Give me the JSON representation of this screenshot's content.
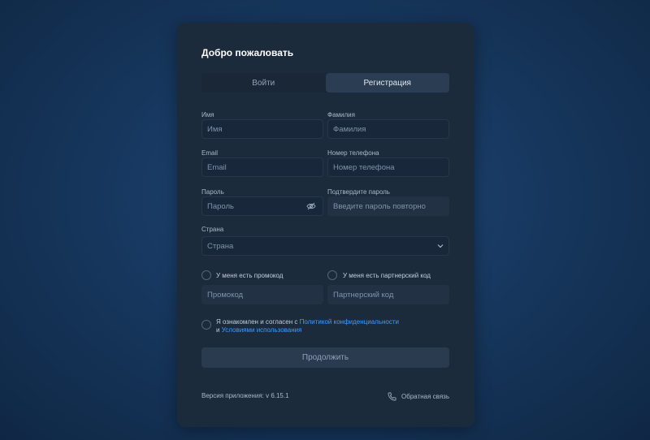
{
  "card": {
    "title": "Добро пожаловать",
    "tabs": [
      {
        "label": "Войти",
        "active": false
      },
      {
        "label": "Регистрация",
        "active": true
      }
    ]
  },
  "form": {
    "first_name": {
      "label": "Имя",
      "placeholder": "Имя"
    },
    "last_name": {
      "label": "Фамилия",
      "placeholder": "Фамилия"
    },
    "email": {
      "label": "Email",
      "placeholder": "Email"
    },
    "phone": {
      "label": "Номер телефона",
      "placeholder": "Номер телефона"
    },
    "password": {
      "label": "Пароль",
      "placeholder": "Пароль",
      "icon": "eye-off-icon"
    },
    "confirm_password": {
      "label": "Подтвердите пароль",
      "placeholder": "Введите пароль повторно"
    },
    "country": {
      "label": "Страна",
      "placeholder": "Страна",
      "icon": "chevron-down-icon"
    },
    "promo": {
      "checkbox_label": "У меня есть промокод",
      "placeholder": "Промокод"
    },
    "partner": {
      "checkbox_label": "У меня есть партнерский код",
      "placeholder": "Партнерский код"
    },
    "consent": {
      "prefix": "Я ознакомлен и согласен с ",
      "privacy_link": "Политикой конфиденциальности",
      "and": "и ",
      "terms_link": "Условиями использования"
    },
    "continue_label": "Продолжить"
  },
  "footer": {
    "version": "Версия приложения: v 6.15.1",
    "feedback_label": "Обратная связь",
    "feedback_icon": "phone-icon"
  },
  "colors": {
    "accent_link": "#3f9bff",
    "card_bg": "#1c2b3c",
    "page_bg": "#17385f"
  }
}
